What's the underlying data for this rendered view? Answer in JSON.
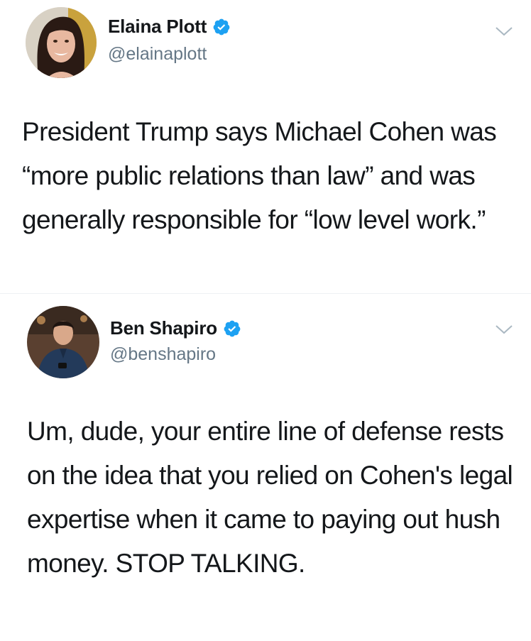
{
  "tweets": [
    {
      "display_name": "Elaina Plott",
      "handle": "@elainaplott",
      "verified": true,
      "text": "President Trump says Michael Cohen was “more public relations than law” and was generally responsible for “low level work.”",
      "avatar_icon": "profile-photo-woman"
    },
    {
      "display_name": "Ben Shapiro",
      "handle": "@benshapiro",
      "verified": true,
      "text": "Um, dude, your entire line of defense rests on the idea that you relied on Cohen's legal expertise when it came to paying out hush money. STOP TALKING.",
      "avatar_icon": "profile-photo-man"
    }
  ],
  "colors": {
    "verified_badge": "#1da1f2",
    "handle_text": "#657786",
    "body_text": "#14171a",
    "chevron": "#aab8c2"
  }
}
